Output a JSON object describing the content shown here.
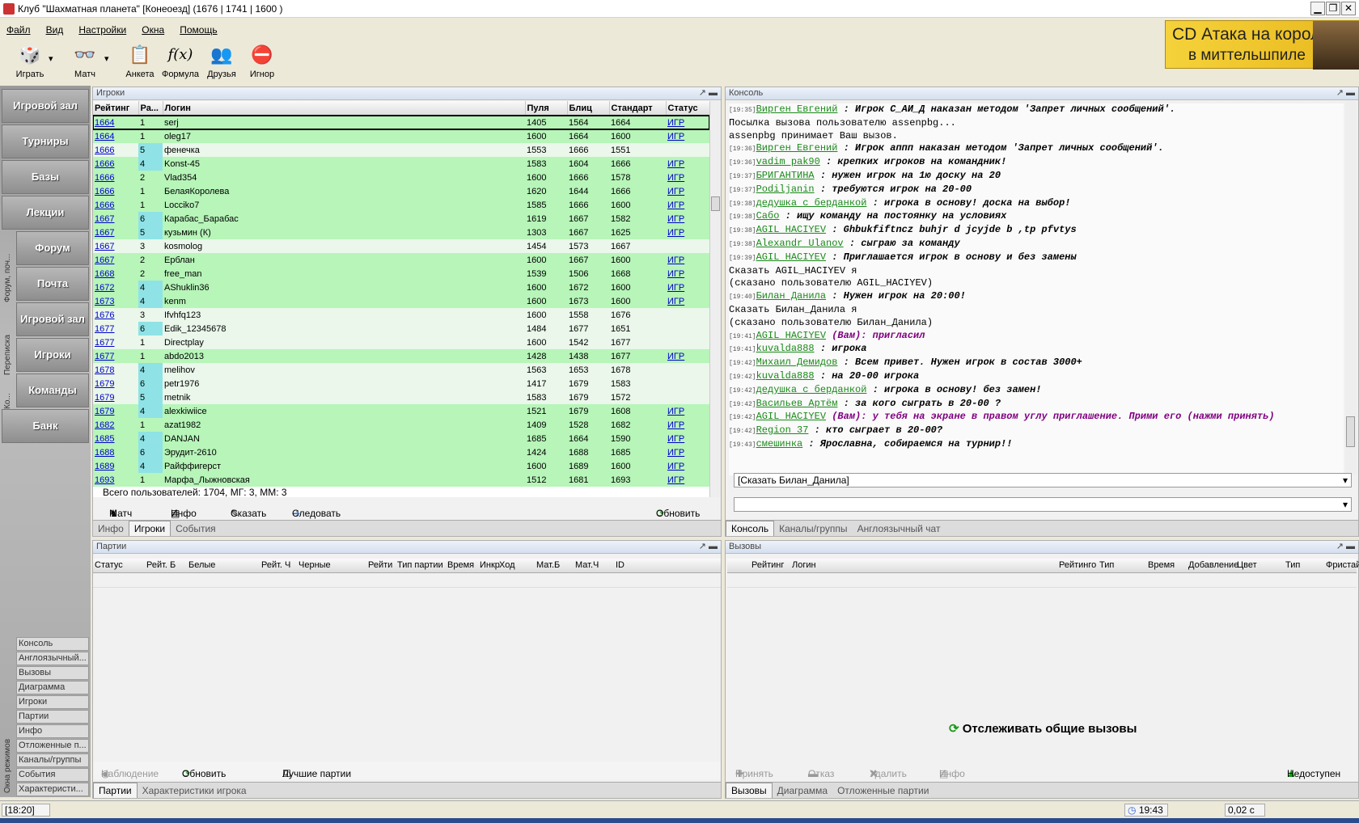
{
  "window": {
    "title": "Клуб \"Шахматная планета\" [Конеоезд]  (1676 | 1741 | 1600 )",
    "btn_min": "▁",
    "btn_max": "❐",
    "btn_close": "✕"
  },
  "menu": {
    "file": "Файл",
    "view": "Вид",
    "settings": "Настройки",
    "windows": "Окна",
    "help": "Помощь"
  },
  "toolbar": {
    "play": "Играть",
    "match": "Матч",
    "profile": "Анкета",
    "formula": "Формула",
    "friends": "Друзья",
    "ignore": "Игнор",
    "play_icon": "🎲",
    "match_icon": "👓",
    "profile_icon": "📋",
    "formula_icon": "f(x)",
    "friends_icon": "👥",
    "ignore_icon": "⛔",
    "dropdown": "▾"
  },
  "ad": {
    "line1": "CD Атака на короля",
    "line2": "в миттельшпиле"
  },
  "leftnav": {
    "buttons": [
      "Игровой зал",
      "Турниры",
      "Базы",
      "Лекции",
      "Форум",
      "Почта",
      "Игровой зал",
      "Игроки",
      "Команды",
      "Банк"
    ],
    "vertical1": "Форум, поч...",
    "vertical2": "Переписка",
    "vertical3": "Ко...",
    "vertical4": "Окна режимов",
    "list": [
      "Консоль",
      "Англоязычный...",
      "Вызовы",
      "Диаграмма",
      "Игроки",
      "Партии",
      "Инфо",
      "Отложенные п...",
      "Каналы/группы",
      "События",
      "Характеристи..."
    ]
  },
  "players": {
    "title": "Игроки",
    "pin": "↗ ▬",
    "columns": [
      "Рейтинг",
      "Ра...",
      "Логин",
      "Пуля",
      "Блиц",
      "Стандарт",
      "Статус"
    ],
    "rows": [
      [
        "1664",
        "1",
        "serj",
        "1405",
        "1564",
        "1664",
        "ИГР"
      ],
      [
        "1664",
        "1",
        "oleg17",
        "1600",
        "1664",
        "1600",
        "ИГР"
      ],
      [
        "1666",
        "5",
        "фенечка",
        "1553",
        "1666",
        "1551",
        ""
      ],
      [
        "1666",
        "4",
        "Konst-45",
        "1583",
        "1604",
        "1666",
        "ИГР"
      ],
      [
        "1666",
        "2",
        "Vlad354",
        "1600",
        "1666",
        "1578",
        "ИГР"
      ],
      [
        "1666",
        "1",
        "БелаяКоролева",
        "1620",
        "1644",
        "1666",
        "ИГР"
      ],
      [
        "1666",
        "1",
        "Locciko7",
        "1585",
        "1666",
        "1600",
        "ИГР"
      ],
      [
        "1667",
        "6",
        "Карабас_Барабас",
        "1619",
        "1667",
        "1582",
        "ИГР"
      ],
      [
        "1667",
        "5",
        "кузьмин (К)",
        "1303",
        "1667",
        "1625",
        "ИГР"
      ],
      [
        "1667",
        "3",
        "kosmolog",
        "1454",
        "1573",
        "1667",
        ""
      ],
      [
        "1667",
        "2",
        "Ерблан",
        "1600",
        "1667",
        "1600",
        "ИГР"
      ],
      [
        "1668",
        "2",
        "free_man",
        "1539",
        "1506",
        "1668",
        "ИГР"
      ],
      [
        "1672",
        "4",
        "AShuklin36",
        "1600",
        "1672",
        "1600",
        "ИГР"
      ],
      [
        "1673",
        "4",
        "kenm",
        "1600",
        "1673",
        "1600",
        "ИГР"
      ],
      [
        "1676",
        "3",
        "Ifvhfq123",
        "1600",
        "1558",
        "1676",
        ""
      ],
      [
        "1677",
        "6",
        "Edik_12345678",
        "1484",
        "1677",
        "1651",
        ""
      ],
      [
        "1677",
        "1",
        "Directplay",
        "1600",
        "1542",
        "1677",
        ""
      ],
      [
        "1677",
        "1",
        "abdo2013",
        "1428",
        "1438",
        "1677",
        "ИГР"
      ],
      [
        "1678",
        "4",
        "melihov",
        "1563",
        "1653",
        "1678",
        ""
      ],
      [
        "1679",
        "6",
        "petr1976",
        "1417",
        "1679",
        "1583",
        ""
      ],
      [
        "1679",
        "5",
        "metnik",
        "1583",
        "1679",
        "1572",
        ""
      ],
      [
        "1679",
        "4",
        "alexkiwiice",
        "1521",
        "1679",
        "1608",
        "ИГР"
      ],
      [
        "1682",
        "1",
        "azat1982",
        "1409",
        "1528",
        "1682",
        "ИГР"
      ],
      [
        "1685",
        "4",
        "DANJAN",
        "1685",
        "1664",
        "1590",
        "ИГР"
      ],
      [
        "1688",
        "6",
        "Эрудит-2610",
        "1424",
        "1688",
        "1685",
        "ИГР"
      ],
      [
        "1689",
        "4",
        "Райффигерст",
        "1600",
        "1689",
        "1600",
        "ИГР"
      ],
      [
        "1693",
        "1",
        "Марфа_Лыжновская",
        "1512",
        "1681",
        "1693",
        "ИГР"
      ]
    ],
    "footer": "Всего пользователей: 1704, МГ: 3, ММ: 3",
    "actions": {
      "match": "Матч",
      "info": "Инфо",
      "say": "Сказать",
      "follow": "Следовать",
      "refresh": "Обновить"
    },
    "tabs": [
      "Инфо",
      "Игроки",
      "События"
    ]
  },
  "console": {
    "title": "Консоль",
    "lines": [
      {
        "t": "[19:35]",
        "n": "Вирген Евгений",
        "m": " : Игрок С_АИ_Д наказан методом 'Запрет личных сообщений'."
      },
      {
        "t": "",
        "n": "",
        "m": "Посылка вызова пользователю assenpbg..."
      },
      {
        "t": "",
        "n": "",
        "m": "assenpbg принимает Ваш вызов."
      },
      {
        "t": "[19:36]",
        "n": "Вирген Евгений",
        "m": " : Игрок аппп наказан методом 'Запрет личных сообщений'."
      },
      {
        "t": "[19:36]",
        "n": "vadim pak90",
        "m": " : крепких игроков на командник!"
      },
      {
        "t": "[19:37]",
        "n": "БРИГАНТИНА",
        "m": " : нужен игрок на 1ю доску на 20"
      },
      {
        "t": "[19:37]",
        "n": "Podiljanin",
        "m": " : требуются игрок на 20-00"
      },
      {
        "t": "[19:38]",
        "n": "дедушка с берданкой",
        "m": " : игрока в основу! доска на выбор!"
      },
      {
        "t": "[19:38]",
        "n": "Сабо",
        "m": " : ищу команду на постоянку на условиях"
      },
      {
        "t": "[19:38]",
        "n": "AGIL HACIYEV",
        "m": " : Ghbukfiftncz buhjr d jcyjde b ,tp pfvtys"
      },
      {
        "t": "[19:38]",
        "n": "Alexandr Ulanov",
        "m": " : сыграю за команду"
      },
      {
        "t": "[19:39]",
        "n": "AGIL HACIYEV",
        "m": " : Приглашается  игрок в основу и без замены"
      },
      {
        "t": "",
        "n": "",
        "m": "Сказать AGIL_HACIYEV я"
      },
      {
        "t": "",
        "n": "",
        "m": "(сказано пользователю AGIL_HACIYEV)"
      },
      {
        "t": "[19:40]",
        "n": "Билан Данила",
        "m": " : Нужен игрок на 20:00!"
      },
      {
        "t": "",
        "n": "",
        "m": "Сказать Билан_Данила я"
      },
      {
        "t": "",
        "n": "",
        "m": "(сказано пользователю Билан_Данила)"
      },
      {
        "t": "[19:41]",
        "n": "AGIL HACIYEV",
        "m": " (Вам): пригласил"
      },
      {
        "t": "[19:41]",
        "n": "kuvalda888",
        "m": " : игрока"
      },
      {
        "t": "[19:42]",
        "n": "Михаил Демидов",
        "m": " : Всем привет. Нужен игрок в состав 3000+"
      },
      {
        "t": "[19:42]",
        "n": "kuvalda888",
        "m": " : на 20-00 игрока"
      },
      {
        "t": "[19:42]",
        "n": "дедушка с берданкой",
        "m": " : игрока в основу! без замен!"
      },
      {
        "t": "[19:42]",
        "n": "Васильев Артём",
        "m": " : за кого сыграть в 20-00 ?"
      },
      {
        "t": "[19:42]",
        "n": "AGIL HACIYEV",
        "m": " (Вам): у тебя на экране в правом углу приглашение. Прими его (нажми принять)"
      },
      {
        "t": "[19:42]",
        "n": "Region 37",
        "m": " : кто сыграет в 20-00?"
      },
      {
        "t": "[19:43]",
        "n": "смешинка",
        "m": " : Ярославна, собираемся на турнир!!"
      }
    ],
    "say_target": "[Сказать Билан_Данила]",
    "input_value": "",
    "tabs": [
      "Консоль",
      "Каналы/группы",
      "Англоязычный чат"
    ]
  },
  "games": {
    "title": "Партии",
    "columns": [
      "Статус",
      "Рейт. Б",
      "Белые",
      "Рейт. Ч",
      "Черные",
      "Рейти",
      "Тип партии",
      "Время",
      "Инкр",
      "Ход",
      "Мат.Б",
      "Мат.Ч",
      "ID"
    ],
    "actions": {
      "observe": "Наблюдение",
      "refresh": "Обновить",
      "best": "Лучшие партии"
    },
    "best_checked": true,
    "tabs": [
      "Партии",
      "Характеристики игрока"
    ]
  },
  "challenges": {
    "title": "Вызовы",
    "columns": [
      "Рейтинг",
      "Логин",
      "Рейтинго",
      "Тип",
      "Время",
      "Добавление",
      "Цвет",
      "Тип",
      "Фристайл"
    ],
    "track": "Отслеживать общие вызовы",
    "actions": {
      "accept": "Принять",
      "decline": "Отказ",
      "delete": "Удалить",
      "info": "Инфо",
      "unavailable": "Недоступен"
    },
    "tabs": [
      "Вызовы",
      "Диаграмма",
      "Отложенные партии"
    ]
  },
  "statusbar": {
    "time_left": "[18:20]",
    "clock": "19:43",
    "lag": "0,02 с"
  }
}
